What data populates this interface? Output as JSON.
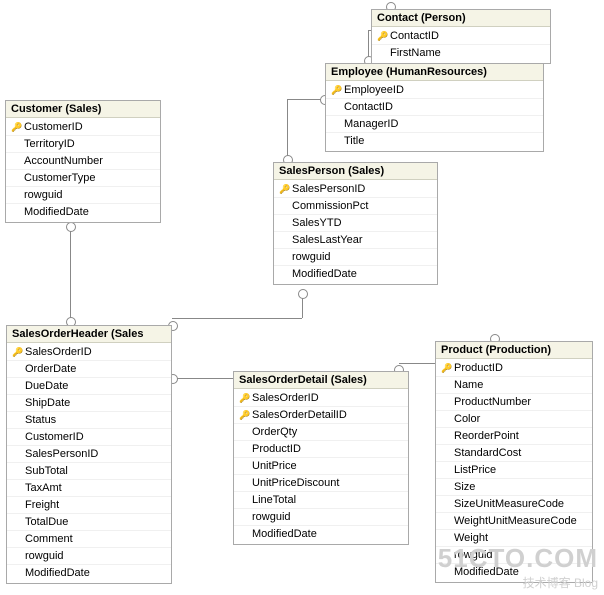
{
  "tables": {
    "customer": {
      "title": "Customer (Sales)",
      "columns": [
        {
          "name": "CustomerID",
          "pk": true
        },
        {
          "name": "TerritoryID",
          "pk": false
        },
        {
          "name": "AccountNumber",
          "pk": false
        },
        {
          "name": "CustomerType",
          "pk": false
        },
        {
          "name": "rowguid",
          "pk": false
        },
        {
          "name": "ModifiedDate",
          "pk": false
        }
      ]
    },
    "contact": {
      "title": "Contact (Person)",
      "columns": [
        {
          "name": "ContactID",
          "pk": true
        },
        {
          "name": "FirstName",
          "pk": false
        }
      ]
    },
    "employee": {
      "title": "Employee (HumanResources)",
      "columns": [
        {
          "name": "EmployeeID",
          "pk": true
        },
        {
          "name": "ContactID",
          "pk": false
        },
        {
          "name": "ManagerID",
          "pk": false
        },
        {
          "name": "Title",
          "pk": false
        }
      ]
    },
    "salesperson": {
      "title": "SalesPerson (Sales)",
      "columns": [
        {
          "name": "SalesPersonID",
          "pk": true
        },
        {
          "name": "CommissionPct",
          "pk": false
        },
        {
          "name": "SalesYTD",
          "pk": false
        },
        {
          "name": "SalesLastYear",
          "pk": false
        },
        {
          "name": "rowguid",
          "pk": false
        },
        {
          "name": "ModifiedDate",
          "pk": false
        }
      ]
    },
    "soh": {
      "title": "SalesOrderHeader (Sales",
      "columns": [
        {
          "name": "SalesOrderID",
          "pk": true
        },
        {
          "name": "OrderDate",
          "pk": false
        },
        {
          "name": "DueDate",
          "pk": false
        },
        {
          "name": "ShipDate",
          "pk": false
        },
        {
          "name": "Status",
          "pk": false
        },
        {
          "name": "CustomerID",
          "pk": false
        },
        {
          "name": "SalesPersonID",
          "pk": false
        },
        {
          "name": "SubTotal",
          "pk": false
        },
        {
          "name": "TaxAmt",
          "pk": false
        },
        {
          "name": "Freight",
          "pk": false
        },
        {
          "name": "TotalDue",
          "pk": false
        },
        {
          "name": "Comment",
          "pk": false
        },
        {
          "name": "rowguid",
          "pk": false
        },
        {
          "name": "ModifiedDate",
          "pk": false
        }
      ]
    },
    "sod": {
      "title": "SalesOrderDetail (Sales)",
      "columns": [
        {
          "name": "SalesOrderID",
          "pk": true
        },
        {
          "name": "SalesOrderDetailID",
          "pk": true
        },
        {
          "name": "OrderQty",
          "pk": false
        },
        {
          "name": "ProductID",
          "pk": false
        },
        {
          "name": "UnitPrice",
          "pk": false
        },
        {
          "name": "UnitPriceDiscount",
          "pk": false
        },
        {
          "name": "LineTotal",
          "pk": false
        },
        {
          "name": "rowguid",
          "pk": false
        },
        {
          "name": "ModifiedDate",
          "pk": false
        }
      ]
    },
    "product": {
      "title": "Product (Production)",
      "columns": [
        {
          "name": "ProductID",
          "pk": true
        },
        {
          "name": "Name",
          "pk": false
        },
        {
          "name": "ProductNumber",
          "pk": false
        },
        {
          "name": "Color",
          "pk": false
        },
        {
          "name": "ReorderPoint",
          "pk": false
        },
        {
          "name": "StandardCost",
          "pk": false
        },
        {
          "name": "ListPrice",
          "pk": false
        },
        {
          "name": "Size",
          "pk": false
        },
        {
          "name": "SizeUnitMeasureCode",
          "pk": false
        },
        {
          "name": "WeightUnitMeasureCode",
          "pk": false
        },
        {
          "name": "Weight",
          "pk": false
        },
        {
          "name": "rowguid",
          "pk": false
        },
        {
          "name": "ModifiedDate",
          "pk": false
        }
      ]
    }
  },
  "chart_data": {
    "type": "er-diagram",
    "nodes": [
      {
        "id": "customer",
        "label": "Customer (Sales)"
      },
      {
        "id": "contact",
        "label": "Contact (Person)"
      },
      {
        "id": "employee",
        "label": "Employee (HumanResources)"
      },
      {
        "id": "salesperson",
        "label": "SalesPerson (Sales)"
      },
      {
        "id": "soh",
        "label": "SalesOrderHeader (Sales)"
      },
      {
        "id": "sod",
        "label": "SalesOrderDetail (Sales)"
      },
      {
        "id": "product",
        "label": "Product (Production)"
      }
    ],
    "edges": [
      {
        "from": "soh",
        "to": "customer",
        "via": "CustomerID"
      },
      {
        "from": "soh",
        "to": "salesperson",
        "via": "SalesPersonID"
      },
      {
        "from": "sod",
        "to": "soh",
        "via": "SalesOrderID"
      },
      {
        "from": "sod",
        "to": "product",
        "via": "ProductID"
      },
      {
        "from": "salesperson",
        "to": "employee",
        "via": "SalesPersonID=EmployeeID"
      },
      {
        "from": "employee",
        "to": "contact",
        "via": "ContactID"
      },
      {
        "from": "employee",
        "to": "employee",
        "via": "ManagerID"
      }
    ]
  },
  "watermark": {
    "line1": "51CTO.COM",
    "line2": "技术博客      Blog"
  }
}
